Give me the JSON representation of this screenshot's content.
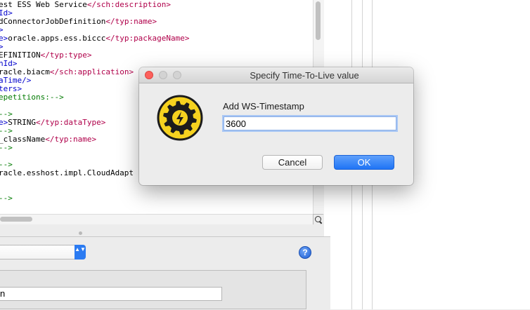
{
  "editor": {
    "lines": [
      [
        {
          "t": "est ESS Web Service",
          "c": "black"
        },
        {
          "t": "</sch:description>",
          "c": "red"
        }
      ],
      [
        {
          "t": "Id>",
          "c": "blue"
        }
      ],
      [
        {
          "t": "dConnectorJobDefinition",
          "c": "black"
        },
        {
          "t": "</typ:name>",
          "c": "red"
        }
      ],
      [
        {
          "t": ">",
          "c": "blue"
        }
      ],
      [
        {
          "t": "e>",
          "c": "blue"
        },
        {
          "t": "oracle.apps.ess.biccc",
          "c": "black"
        },
        {
          "t": "</typ:packageName>",
          "c": "red"
        }
      ],
      [
        {
          "t": ">",
          "c": "blue"
        }
      ],
      [
        {
          "t": "EFINITION",
          "c": "black"
        },
        {
          "t": "</typ:type>",
          "c": "red"
        }
      ],
      [
        {
          "t": "nId>",
          "c": "blue"
        }
      ],
      [
        {
          "t": "racle.biacm",
          "c": "black"
        },
        {
          "t": "</sch:application>",
          "c": "red"
        }
      ],
      [
        {
          "t": "aTime/>",
          "c": "blue"
        }
      ],
      [
        {
          "t": "ters>",
          "c": "blue"
        }
      ],
      [
        {
          "t": "epetitions:-->",
          "c": "green"
        }
      ],
      [
        {
          "t": "",
          "c": "black"
        }
      ],
      [
        {
          "t": "-->",
          "c": "green"
        }
      ],
      [
        {
          "t": "e>",
          "c": "blue"
        },
        {
          "t": "STRING",
          "c": "black"
        },
        {
          "t": "</typ:dataType>",
          "c": "red"
        }
      ],
      [
        {
          "t": "-->",
          "c": "green"
        }
      ],
      [
        {
          "t": "_className",
          "c": "black"
        },
        {
          "t": "</typ:name>",
          "c": "red"
        }
      ],
      [
        {
          "t": "-->",
          "c": "green"
        }
      ],
      [
        {
          "t": "",
          "c": "black"
        }
      ],
      [
        {
          "t": "-->",
          "c": "green"
        }
      ],
      [
        {
          "t": "racle.esshost.impl.CloudAdapt",
          "c": "black"
        }
      ],
      [
        {
          "t": "",
          "c": "black"
        }
      ],
      [
        {
          "t": "",
          "c": "black"
        }
      ],
      [
        {
          "t": "-->",
          "c": "green"
        }
      ]
    ]
  },
  "bottom_panel": {
    "input_value": "n",
    "help_label": "?",
    "select_arrows": "▲▼"
  },
  "dialog": {
    "title": "Specify Time-To-Live value",
    "field_label": "Add WS-Timestamp",
    "input_value": "3600",
    "cancel_label": "Cancel",
    "ok_label": "OK",
    "logo_icon": "gear-lightning-icon"
  },
  "colors": {
    "accent": "#2b7bf2",
    "close": "#fc605c",
    "logo_yellow": "#f6d21f",
    "logo_ring": "#1c1c1c"
  }
}
